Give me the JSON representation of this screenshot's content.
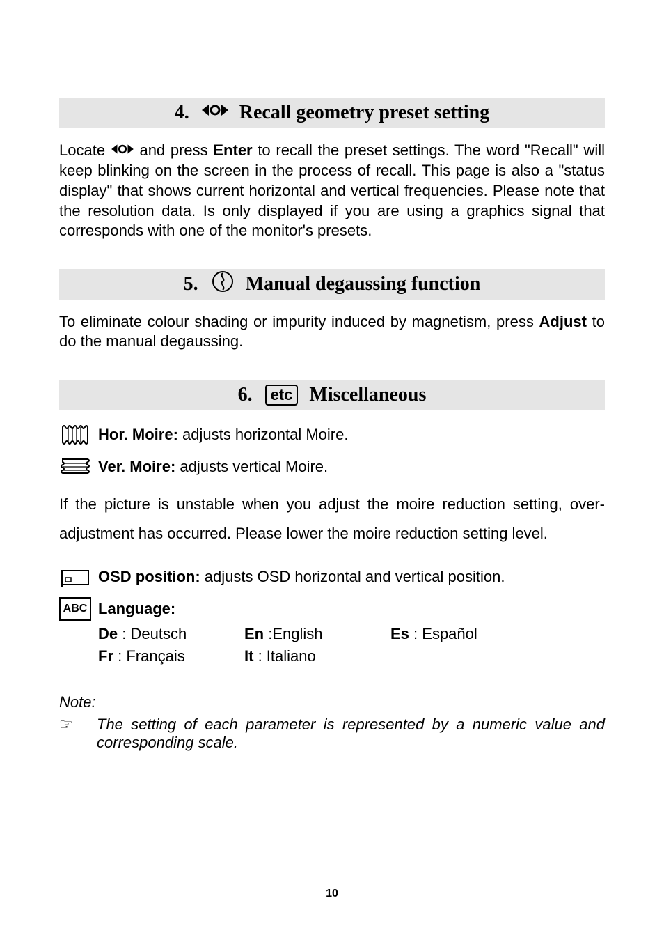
{
  "section4": {
    "num": "4.",
    "title": "Recall geometry preset setting",
    "p_pre": "Locate",
    "p_mid1": " and press ",
    "enter": "Enter",
    "p_rest": " to recall the preset settings.  The word \"Recall\" will keep blinking on the screen in the process of recall.  This page is also a \"status display\" that shows current horizontal and vertical frequencies.  Please note that the resolution data. Is only displayed if you are using a graphics signal that corresponds with one of the monitor's presets."
  },
  "section5": {
    "num": "5.",
    "title": "Manual degaussing function",
    "p_pre": "To eliminate colour shading or impurity induced by magnetism, press ",
    "adjust": "Adjust",
    "p_post": " to do the manual degaussing."
  },
  "section6": {
    "num": "6.",
    "etc": "etc",
    "title": "Miscellaneous",
    "hor_label": "Hor. Moire:",
    "hor_desc": " adjusts horizontal Moire.",
    "ver_label": "Ver. Moire:",
    "ver_desc": " adjusts vertical Moire.",
    "moire_para": "If the picture is unstable when you adjust the moire reduction setting, over-adjustment has occurred.  Please lower the moire reduction setting level.",
    "osd_label": "OSD position:",
    "osd_desc": " adjusts OSD horizontal and vertical position.",
    "abc": "ABC",
    "language_label": "Language:",
    "langs": {
      "de_code": "De",
      "de_sep": " : ",
      "de_name": "Deutsch",
      "en_code": "En",
      "en_sep": " :",
      "en_name": "English",
      "es_code": "Es",
      "es_sep": " :  ",
      "es_name": "Español",
      "fr_code": "Fr",
      "fr_sep": " :  ",
      "fr_name": "Français",
      "it_code": "It",
      "it_sep": " :   ",
      "it_name": "Italiano"
    }
  },
  "note": {
    "head": "Note:",
    "bullet": "☞",
    "text": "The setting of each parameter is represented by a numeric value and corresponding scale."
  },
  "page_number": "10"
}
